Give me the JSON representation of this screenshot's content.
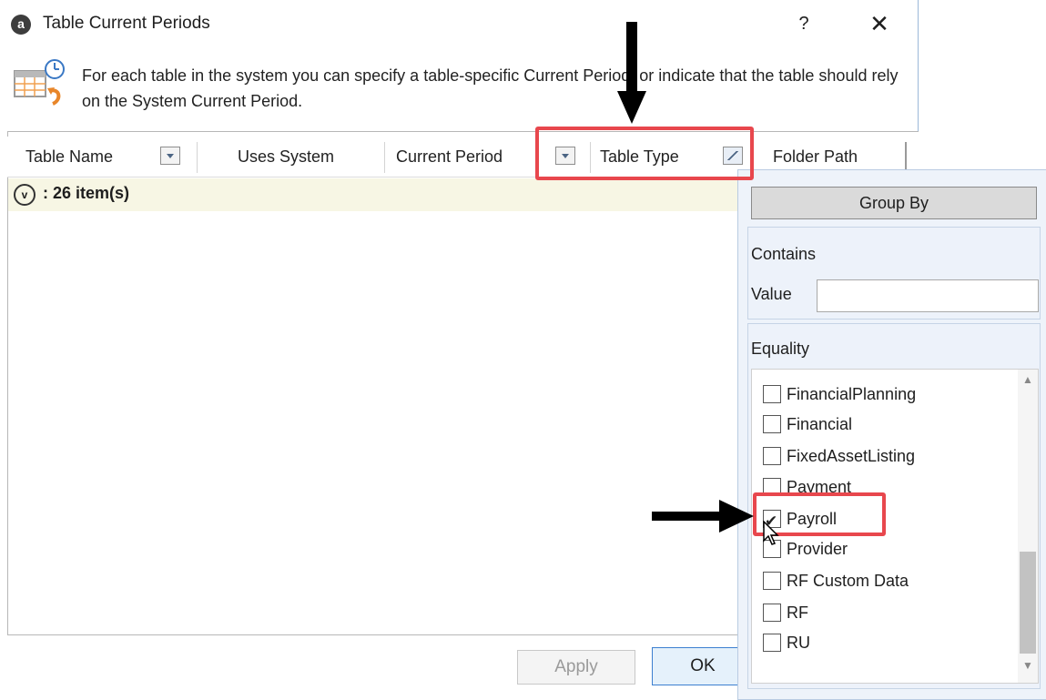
{
  "window": {
    "title": "Table Current Periods",
    "app_icon_letter": "a",
    "help_label": "?",
    "close_label": "✕"
  },
  "info": {
    "text": "For each table in the system you can specify a table-specific Current Period, or indicate that the table should rely on the System Current Period."
  },
  "grid": {
    "columns": [
      "Table Name",
      "Uses System",
      "Current Period",
      "Table Type",
      "Folder Path"
    ],
    "group_summary": ": 26 item(s)"
  },
  "buttons": {
    "apply": "Apply",
    "ok": "OK"
  },
  "filter_popup": {
    "group_by": "Group By",
    "contains_label": "Contains",
    "value_label": "Value",
    "value": "",
    "equality_label": "Equality",
    "items": [
      {
        "label": "FinancialPlanning",
        "checked": false
      },
      {
        "label": "Financial",
        "checked": false
      },
      {
        "label": "FixedAssetListing",
        "checked": false
      },
      {
        "label": "Payment",
        "checked": false
      },
      {
        "label": "Payroll",
        "checked": true
      },
      {
        "label": "Provider",
        "checked": false
      },
      {
        "label": "RF Custom Data",
        "checked": false
      },
      {
        "label": "RF",
        "checked": false
      },
      {
        "label": "RU",
        "checked": false
      }
    ]
  },
  "colors": {
    "highlight_box": "#e8474d",
    "group_row_bg": "#f7f6e4",
    "popup_bg": "#eef3fa",
    "ok_border": "#3c7fd0"
  }
}
